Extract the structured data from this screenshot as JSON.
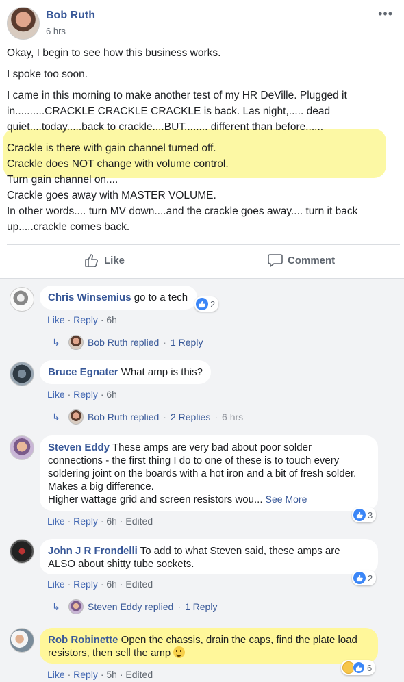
{
  "post": {
    "author": "Bob Ruth",
    "time": "6 hrs",
    "more_icon": "more-dots-icon",
    "lines": [
      "Okay, I begin to see how this business works.",
      "I spoke too soon.",
      "I came in this morning to make another test of my HR DeVille. Plugged it",
      "in..........CRACKLE CRACKLE CRACKLE is back. Las night,..... dead",
      "quiet....today.....back to crackle....BUT........ different than before......",
      "Crackle is there with gain channel turned off.",
      "Crackle does NOT change with volume control.",
      "Turn gain channel on....",
      "Crackle goes away with MASTER VOLUME.",
      "In other words.... turn MV down....and the crackle goes away.... turn it back",
      "up.....crackle comes back."
    ],
    "highlight_color": "#fcf79a"
  },
  "actions": {
    "like_label": "Like",
    "comment_label": "Comment"
  },
  "comments": [
    {
      "name": "Chris Winsemius",
      "text": "go to a tech",
      "like": "Like",
      "reply": "Reply",
      "time": "6h",
      "reactions": "2",
      "replies": {
        "who": "Bob Ruth replied",
        "count": "1 Reply",
        "time": ""
      }
    },
    {
      "name": "Bruce Egnater",
      "text": "What amp is this?",
      "like": "Like",
      "reply": "Reply",
      "time": "6h",
      "replies": {
        "who": "Bob Ruth replied",
        "count": "2 Replies",
        "time": "6 hrs"
      }
    },
    {
      "name": "Steven Eddy",
      "text_lines": [
        "These amps are very bad about poor solder",
        "connections - the first thing I do to one of these is to touch every",
        "soldering joint on the boards with a hot iron and a bit of fresh solder.",
        "Makes a big difference.",
        "Higher wattage grid and screen resistors wou..."
      ],
      "see_more": "See More",
      "like": "Like",
      "reply": "Reply",
      "time": "6h",
      "edited": "Edited",
      "reactions": "3"
    },
    {
      "name": "John J R Frondelli",
      "text_lines": [
        "To add to what Steven said, these amps are",
        "ALSO about shitty tube sockets."
      ],
      "like": "Like",
      "reply": "Reply",
      "time": "6h",
      "edited": "Edited",
      "reactions": "2",
      "replies": {
        "who": "Steven Eddy replied",
        "count": "1 Reply"
      }
    },
    {
      "name": "Rob Robinette",
      "text_lines": [
        "Open the chassis, drain the caps, find the plate load",
        "resistors, then sell the amp"
      ],
      "like": "Like",
      "reply": "Reply",
      "time": "5h",
      "edited": "Edited",
      "reactions": "6",
      "highlight_color": "#fff79a"
    }
  ],
  "separator": "·"
}
